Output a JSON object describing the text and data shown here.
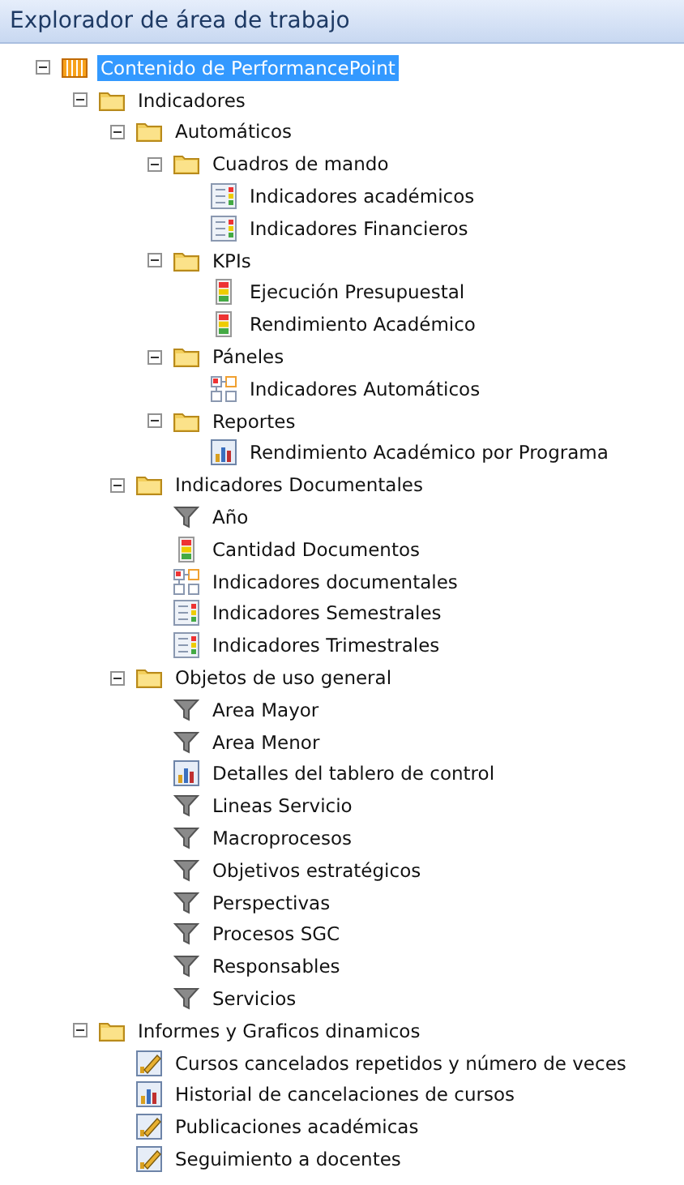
{
  "panel": {
    "title": "Explorador de área de trabajo"
  },
  "tree": [
    {
      "label": "Contenido de PerformancePoint",
      "kind": "root",
      "expanded": true,
      "selected": true,
      "children": [
        {
          "label": "Indicadores",
          "kind": "folder",
          "expanded": true,
          "selected": false,
          "children": [
            {
              "label": "Automáticos",
              "kind": "folder",
              "expanded": true,
              "selected": false,
              "children": [
                {
                  "label": "Cuadros de mando",
                  "kind": "folder",
                  "expanded": true,
                  "selected": false,
                  "children": [
                    {
                      "label": "Indicadores académicos",
                      "kind": "scorecard",
                      "selected": false
                    },
                    {
                      "label": "Indicadores Financieros",
                      "kind": "scorecard",
                      "selected": false
                    }
                  ]
                },
                {
                  "label": "KPIs",
                  "kind": "folder",
                  "expanded": true,
                  "selected": false,
                  "children": [
                    {
                      "label": "Ejecución Presupuestal",
                      "kind": "kpi",
                      "selected": false
                    },
                    {
                      "label": "Rendimiento Académico",
                      "kind": "kpi",
                      "selected": false
                    }
                  ]
                },
                {
                  "label": "Páneles",
                  "kind": "folder",
                  "expanded": true,
                  "selected": false,
                  "children": [
                    {
                      "label": "Indicadores Automáticos",
                      "kind": "dashboard",
                      "selected": false
                    }
                  ]
                },
                {
                  "label": "Reportes",
                  "kind": "folder",
                  "expanded": true,
                  "selected": false,
                  "children": [
                    {
                      "label": "Rendimiento Académico por Programa",
                      "kind": "report",
                      "selected": false
                    }
                  ]
                }
              ]
            },
            {
              "label": "Indicadores Documentales",
              "kind": "folder",
              "expanded": true,
              "selected": false,
              "children": [
                {
                  "label": "Año",
                  "kind": "filter",
                  "selected": false
                },
                {
                  "label": "Cantidad Documentos",
                  "kind": "kpi",
                  "selected": false
                },
                {
                  "label": "Indicadores documentales",
                  "kind": "dashboard",
                  "selected": false
                },
                {
                  "label": "Indicadores Semestrales",
                  "kind": "scorecard",
                  "selected": false
                },
                {
                  "label": "Indicadores Trimestrales",
                  "kind": "scorecard",
                  "selected": false
                }
              ]
            },
            {
              "label": "Objetos de uso general",
              "kind": "folder",
              "expanded": true,
              "selected": false,
              "children": [
                {
                  "label": "Area Mayor",
                  "kind": "filter",
                  "selected": false
                },
                {
                  "label": "Area Menor",
                  "kind": "filter",
                  "selected": false
                },
                {
                  "label": "Detalles del tablero de control",
                  "kind": "report",
                  "selected": false
                },
                {
                  "label": "Lineas Servicio",
                  "kind": "filter",
                  "selected": false
                },
                {
                  "label": "Macroprocesos",
                  "kind": "filter",
                  "selected": false
                },
                {
                  "label": "Objetivos estratégicos",
                  "kind": "filter",
                  "selected": false
                },
                {
                  "label": "Perspectivas",
                  "kind": "filter",
                  "selected": false
                },
                {
                  "label": "Procesos SGC",
                  "kind": "filter",
                  "selected": false
                },
                {
                  "label": "Responsables",
                  "kind": "filter",
                  "selected": false
                },
                {
                  "label": "Servicios",
                  "kind": "filter",
                  "selected": false
                }
              ]
            }
          ]
        },
        {
          "label": "Informes y Graficos dinamicos",
          "kind": "folder",
          "expanded": true,
          "selected": false,
          "children": [
            {
              "label": "Cursos cancelados repetidos y número de veces",
              "kind": "analytic",
              "selected": false
            },
            {
              "label": "Historial de cancelaciones de cursos",
              "kind": "report",
              "selected": false
            },
            {
              "label": "Publicaciones académicas",
              "kind": "analytic",
              "selected": false
            },
            {
              "label": "Seguimiento a docentes",
              "kind": "analytic",
              "selected": false
            }
          ]
        }
      ]
    }
  ]
}
